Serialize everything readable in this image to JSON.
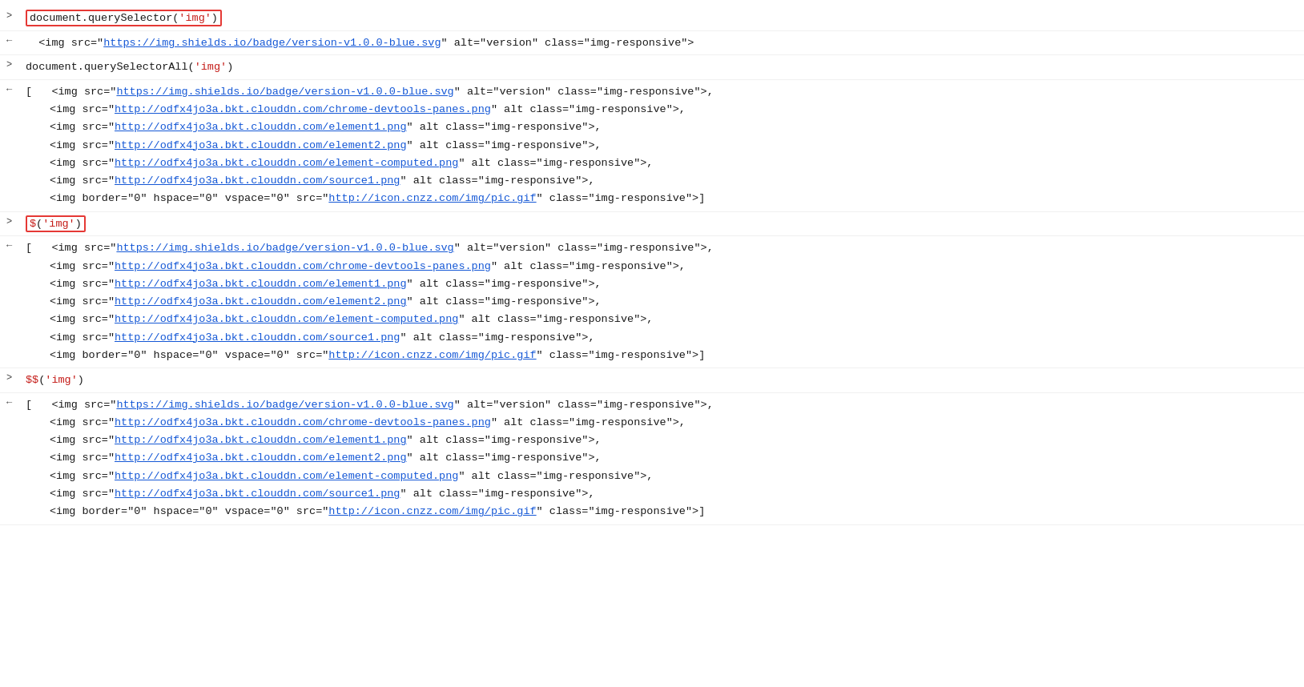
{
  "console": {
    "entries": [
      {
        "id": "entry-1",
        "type": "input",
        "arrow": ">",
        "highlighted": true,
        "content_parts": [
          {
            "type": "text",
            "text": "document.querySelector("
          },
          {
            "type": "string",
            "text": "'img'"
          },
          {
            "type": "text",
            "text": ")"
          }
        ]
      },
      {
        "id": "entry-2",
        "type": "output",
        "arrow": "←",
        "content_parts": [
          {
            "type": "text",
            "text": "  <img src=\""
          },
          {
            "type": "link",
            "text": "https://img.shields.io/badge/version-v1.0.0-blue.svg"
          },
          {
            "type": "text",
            "text": "\" alt=\"version\" class=\"img-responsive\">"
          }
        ]
      },
      {
        "id": "entry-3",
        "type": "input",
        "arrow": ">",
        "highlighted": false,
        "content_parts": [
          {
            "type": "text",
            "text": "document.querySelectorAll("
          },
          {
            "type": "string",
            "text": "'img'"
          },
          {
            "type": "text",
            "text": ")"
          }
        ]
      },
      {
        "id": "entry-4",
        "type": "output-array",
        "arrow": "←",
        "lines": [
          {
            "prefix": "[  ",
            "tag_open": "<img src=\"",
            "link": "https://img.shields.io/badge/version-v1.0.0-blue.svg",
            "tag_after": "\" alt=\"version\" class=\"img-responsive\">,"
          },
          {
            "prefix": "    ",
            "tag_open": "<img src=\"",
            "link": "http://odfx4jo3a.bkt.clouddn.com/chrome-devtools-panes.png",
            "tag_after": "\" alt class=\"img-responsive\">,"
          },
          {
            "prefix": "    ",
            "tag_open": "<img src=\"",
            "link": "http://odfx4jo3a.bkt.clouddn.com/element1.png",
            "tag_after": "\" alt class=\"img-responsive\">,"
          },
          {
            "prefix": "    ",
            "tag_open": "<img src=\"",
            "link": "http://odfx4jo3a.bkt.clouddn.com/element2.png",
            "tag_after": "\" alt class=\"img-responsive\">,"
          },
          {
            "prefix": "    ",
            "tag_open": "<img src=\"",
            "link": "http://odfx4jo3a.bkt.clouddn.com/element-computed.png",
            "tag_after": "\" alt class=\"img-responsive\">,"
          },
          {
            "prefix": "    ",
            "tag_open": "<img src=\"",
            "link": "http://odfx4jo3a.bkt.clouddn.com/source1.png",
            "tag_after": "\" alt class=\"img-responsive\">,"
          },
          {
            "prefix": "    ",
            "tag_open": "<img border=\"0\" hspace=\"0\" vspace=\"0\" src=\"",
            "link": "http://icon.cnzz.com/img/pic.gif",
            "tag_after": "\" class=\"img-responsive\">]"
          }
        ]
      },
      {
        "id": "entry-5",
        "type": "input",
        "arrow": ">",
        "highlighted": true,
        "content_parts": [
          {
            "type": "jquery",
            "text": "$"
          },
          {
            "type": "text",
            "text": "("
          },
          {
            "type": "string",
            "text": "'img'"
          },
          {
            "type": "text",
            "text": ")"
          }
        ]
      },
      {
        "id": "entry-6",
        "type": "output-array",
        "arrow": "←",
        "lines": [
          {
            "prefix": "[  ",
            "tag_open": "<img src=\"",
            "link": "https://img.shields.io/badge/version-v1.0.0-blue.svg",
            "tag_after": "\" alt=\"version\" class=\"img-responsive\">,"
          },
          {
            "prefix": "    ",
            "tag_open": "<img src=\"",
            "link": "http://odfx4jo3a.bkt.clouddn.com/chrome-devtools-panes.png",
            "tag_after": "\" alt class=\"img-responsive\">,"
          },
          {
            "prefix": "    ",
            "tag_open": "<img src=\"",
            "link": "http://odfx4jo3a.bkt.clouddn.com/element1.png",
            "tag_after": "\" alt class=\"img-responsive\">,"
          },
          {
            "prefix": "    ",
            "tag_open": "<img src=\"",
            "link": "http://odfx4jo3a.bkt.clouddn.com/element2.png",
            "tag_after": "\" alt class=\"img-responsive\">,"
          },
          {
            "prefix": "    ",
            "tag_open": "<img src=\"",
            "link": "http://odfx4jo3a.bkt.clouddn.com/element-computed.png",
            "tag_after": "\" alt class=\"img-responsive\">,"
          },
          {
            "prefix": "    ",
            "tag_open": "<img src=\"",
            "link": "http://odfx4jo3a.bkt.clouddn.com/source1.png",
            "tag_after": "\" alt class=\"img-responsive\">,"
          },
          {
            "prefix": "    ",
            "tag_open": "<img border=\"0\" hspace=\"0\" vspace=\"0\" src=\"",
            "link": "http://icon.cnzz.com/img/pic.gif",
            "tag_after": "\" class=\"img-responsive\">]"
          }
        ]
      },
      {
        "id": "entry-7",
        "type": "input",
        "arrow": ">",
        "highlighted": false,
        "content_parts": [
          {
            "type": "jquery",
            "text": "$$"
          },
          {
            "type": "text",
            "text": "("
          },
          {
            "type": "string",
            "text": "'img'"
          },
          {
            "type": "text",
            "text": ")"
          }
        ]
      },
      {
        "id": "entry-8",
        "type": "output-array",
        "arrow": "←",
        "lines": [
          {
            "prefix": "[  ",
            "tag_open": "<img src=\"",
            "link": "https://img.shields.io/badge/version-v1.0.0-blue.svg",
            "tag_after": "\" alt=\"version\" class=\"img-responsive\">,"
          },
          {
            "prefix": "    ",
            "tag_open": "<img src=\"",
            "link": "http://odfx4jo3a.bkt.clouddn.com/chrome-devtools-panes.png",
            "tag_after": "\" alt class=\"img-responsive\">,"
          },
          {
            "prefix": "    ",
            "tag_open": "<img src=\"",
            "link": "http://odfx4jo3a.bkt.clouddn.com/element1.png",
            "tag_after": "\" alt class=\"img-responsive\">,"
          },
          {
            "prefix": "    ",
            "tag_open": "<img src=\"",
            "link": "http://odfx4jo3a.bkt.clouddn.com/element2.png",
            "tag_after": "\" alt class=\"img-responsive\">,"
          },
          {
            "prefix": "    ",
            "tag_open": "<img src=\"",
            "link": "http://odfx4jo3a.bkt.clouddn.com/element-computed.png",
            "tag_after": "\" alt class=\"img-responsive\">,"
          },
          {
            "prefix": "    ",
            "tag_open": "<img src=\"",
            "link": "http://odfx4jo3a.bkt.clouddn.com/source1.png",
            "tag_after": "\" alt class=\"img-responsive\">,"
          },
          {
            "prefix": "    ",
            "tag_open": "<img border=\"0\" hspace=\"0\" vspace=\"0\" src=\"",
            "link": "http://icon.cnzz.com/img/pic.gif",
            "tag_after": "\" class=\"img-responsive\">]"
          }
        ]
      }
    ]
  }
}
